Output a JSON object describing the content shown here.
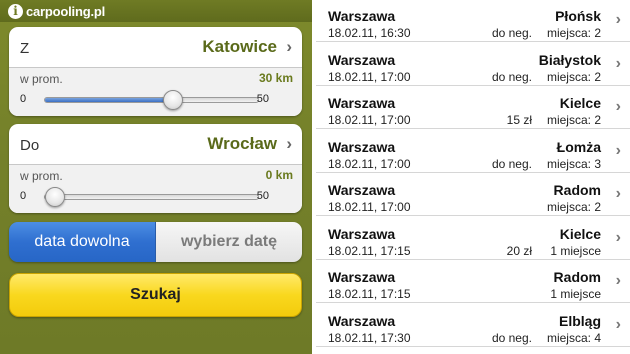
{
  "app": {
    "logo_mark": "i",
    "logo_text": "carpooling.pl"
  },
  "search_form": {
    "from": {
      "label": "Z",
      "value": "Katowice",
      "radius_label": "w prom.",
      "radius_value": "30 km",
      "slider_min": "0",
      "slider_max": "50",
      "slider_fraction": 0.6
    },
    "to": {
      "label": "Do",
      "value": "Wrocław",
      "radius_label": "w prom.",
      "radius_value": "0 km",
      "slider_min": "0",
      "slider_max": "50",
      "slider_fraction": 0.0
    },
    "date": {
      "option_any": "data dowolna",
      "option_pick": "wybierz datę",
      "selected": "data dowolna"
    },
    "search_button": "Szukaj"
  },
  "rides": [
    {
      "from": "Warszawa",
      "to": "Płońsk",
      "datetime": "18.02.11, 16:30",
      "price": "do neg.",
      "seats": "miejsca: 2"
    },
    {
      "from": "Warszawa",
      "to": "Białystok",
      "datetime": "18.02.11, 17:00",
      "price": "do neg.",
      "seats": "miejsca: 2"
    },
    {
      "from": "Warszawa",
      "to": "Kielce",
      "datetime": "18.02.11, 17:00",
      "price": "15 zł",
      "seats": "miejsca: 2"
    },
    {
      "from": "Warszawa",
      "to": "Łomża",
      "datetime": "18.02.11, 17:00",
      "price": "do neg.",
      "seats": "miejsca: 3"
    },
    {
      "from": "Warszawa",
      "to": "Radom",
      "datetime": "18.02.11, 17:00",
      "price": "",
      "seats": "miejsca: 2"
    },
    {
      "from": "Warszawa",
      "to": "Kielce",
      "datetime": "18.02.11, 17:15",
      "price": "20 zł",
      "seats": "1 miejsce"
    },
    {
      "from": "Warszawa",
      "to": "Radom",
      "datetime": "18.02.11, 17:15",
      "price": "",
      "seats": "1 miejsce"
    },
    {
      "from": "Warszawa",
      "to": "Elbląg",
      "datetime": "18.02.11, 17:30",
      "price": "do neg.",
      "seats": "miejsca: 4"
    }
  ],
  "colors": {
    "accent_green": "#5a6a1a",
    "selected_blue": "#2f6fd0",
    "search_yellow": "#f9d81e"
  }
}
